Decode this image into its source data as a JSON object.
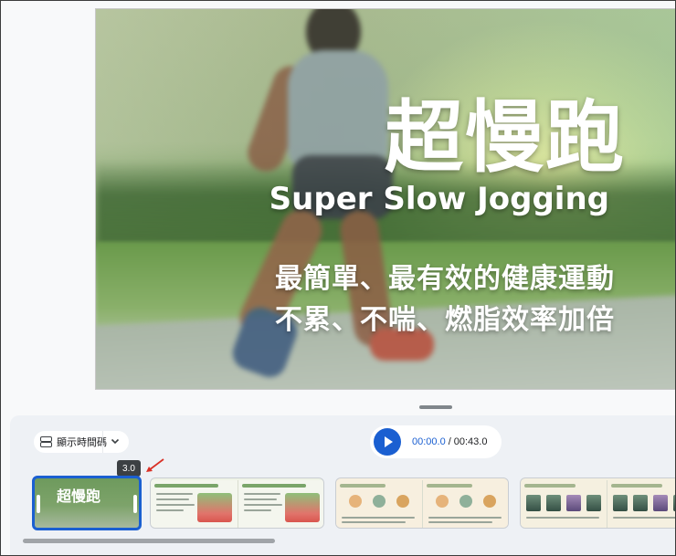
{
  "slide": {
    "title": "超慢跑",
    "subtitle": "Super Slow Jogging",
    "line1": "最簡單、最有效的健康運動",
    "line2": "不累、不喘、燃脂效率加倍"
  },
  "timeline": {
    "timecode_toggle_label": "顯示時間碼",
    "current_time": "00:00.0",
    "separator": "/",
    "total_time": "00:43.0",
    "selected_clip_duration": "3.0",
    "selected_clip_thumb_title": "超慢跑"
  },
  "colors": {
    "accent": "#1a5fd1",
    "tooltip_bg": "#3c4043",
    "annotation_arrow": "#d93025"
  },
  "icons": {
    "timecode": "timecode-icon",
    "dropdown": "chevron-down-icon",
    "play": "play-icon",
    "annotation": "red-arrow-icon"
  }
}
